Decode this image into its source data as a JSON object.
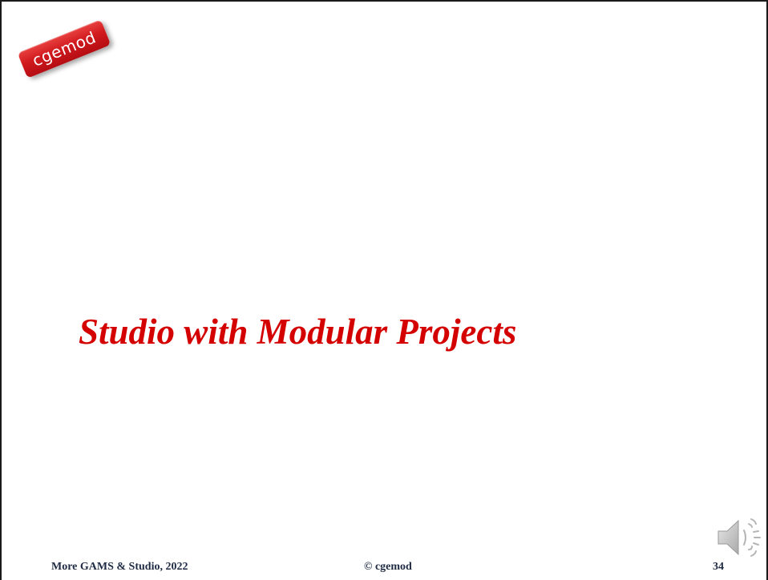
{
  "logo": {
    "text": "cgemod",
    "color": "#d11a1e"
  },
  "slide": {
    "title": "Studio with Modular Projects",
    "title_color": "#d40000"
  },
  "footer": {
    "left": "More GAMS & Studio, 2022",
    "center": "© cgemod",
    "page_number": "34"
  },
  "audio": {
    "icon": "speaker-icon"
  }
}
